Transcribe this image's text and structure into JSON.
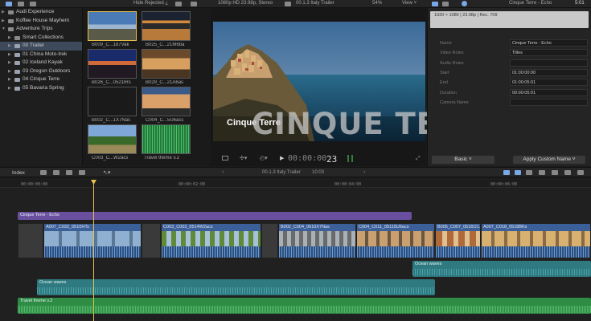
{
  "top_bar": {
    "filter": "Hide Rejected ¿",
    "format": "1080p HD 23.98p, Stereo",
    "project": "00.1.3 Italy Trailer",
    "zoom": "54%",
    "view": "View ˅",
    "inspector_title": "Cinque Terre - Echo",
    "inspector_duration": "5:01"
  },
  "library": {
    "items": [
      {
        "label": "Audi Experience",
        "level": 0,
        "type": "event",
        "expanded": false
      },
      {
        "label": "Koffee House Mayhem",
        "level": 0,
        "type": "event",
        "expanded": false
      },
      {
        "label": "Adventure Trips",
        "level": 0,
        "type": "event",
        "expanded": true
      },
      {
        "label": "Smart Collections",
        "level": 1,
        "type": "folder",
        "expanded": false
      },
      {
        "label": "00 Trailer",
        "level": 1,
        "type": "keyword",
        "expanded": false,
        "selected": true
      },
      {
        "label": "01 China Moto-trek",
        "level": 1,
        "type": "keyword",
        "expanded": false
      },
      {
        "label": "02 Iceland Kayak",
        "level": 1,
        "type": "keyword",
        "expanded": false
      },
      {
        "label": "03 Oregon Outdoors",
        "level": 1,
        "type": "keyword",
        "expanded": false
      },
      {
        "label": "04 Cinque Terre",
        "level": 1,
        "type": "keyword",
        "expanded": false
      },
      {
        "label": "05 Bavaria Spring",
        "level": 1,
        "type": "keyword",
        "expanded": false
      }
    ]
  },
  "browser": {
    "clips": [
      {
        "label": "B009_C...187Vak",
        "selected": true
      },
      {
        "label": "B025_C...21M6ba",
        "selected": false
      },
      {
        "label": "B026_C...0521lRs",
        "selected": false
      },
      {
        "label": "B029_C...21A6as",
        "selected": false
      },
      {
        "label": "B002_C...1X7Nas",
        "selected": false
      },
      {
        "label": "C004_C...5U6acs",
        "selected": false
      },
      {
        "label": "C003_C...W2acs",
        "selected": false
      },
      {
        "label": "Travel theme v.2",
        "selected": false
      }
    ]
  },
  "viewer": {
    "overlay_title": "Cinque Terre",
    "big_title": "CINQUE TERRE",
    "timecode_dim": "00:00:00",
    "timecode_frames": "23"
  },
  "inspector": {
    "format_line": "1920 × 1080 | 23.98p | Rec. 709",
    "properties": [
      {
        "label": "Name",
        "value": "Cinque Terre - Echo"
      },
      {
        "label": "Video Roles",
        "value": "Titles"
      },
      {
        "label": "Audio Roles",
        "value": ""
      },
      {
        "label": "Start",
        "value": "01:00:00:00"
      },
      {
        "label": "End",
        "value": "01:00:05:01"
      },
      {
        "label": "Duration",
        "value": "00:00:05:01"
      },
      {
        "label": "Camera Name",
        "value": ""
      }
    ],
    "basic_button": "Basic ˅",
    "custom_button": "Apply Custom Name ˅"
  },
  "timeline": {
    "index_label": "Index",
    "project_name": "00.1.3 Italy Trailer",
    "project_duration": "10:03",
    "ruler_labels": [
      "00:00:00:00",
      "00:00:02:00",
      "00:00:04:00",
      "00:00:06:00"
    ],
    "title_clip": "Cinque Terre - Echo",
    "video_clips": [
      {
        "label": "A007_C032_0510HTs"
      },
      {
        "label": "C003_C003_0514W2acs"
      },
      {
        "label": "B002_C004_0610X7Nas"
      },
      {
        "label": "C004_C011_05115U6acs"
      },
      {
        "label": "B005_C007_0516O1..."
      },
      {
        "label": "A007_C018_0518BKs"
      }
    ],
    "audio_clips": [
      {
        "label": "Ocean waves"
      },
      {
        "label": "Ocean waves"
      },
      {
        "label": "Travel theme v.2"
      }
    ]
  },
  "colors": {
    "accent": "#4a90e2",
    "title_clip": "#6a4f9e",
    "video_clip": "#3b5f99",
    "audio_clip": "#2f7a80",
    "music_clip": "#2f8c45",
    "playhead": "#e8c04a"
  }
}
